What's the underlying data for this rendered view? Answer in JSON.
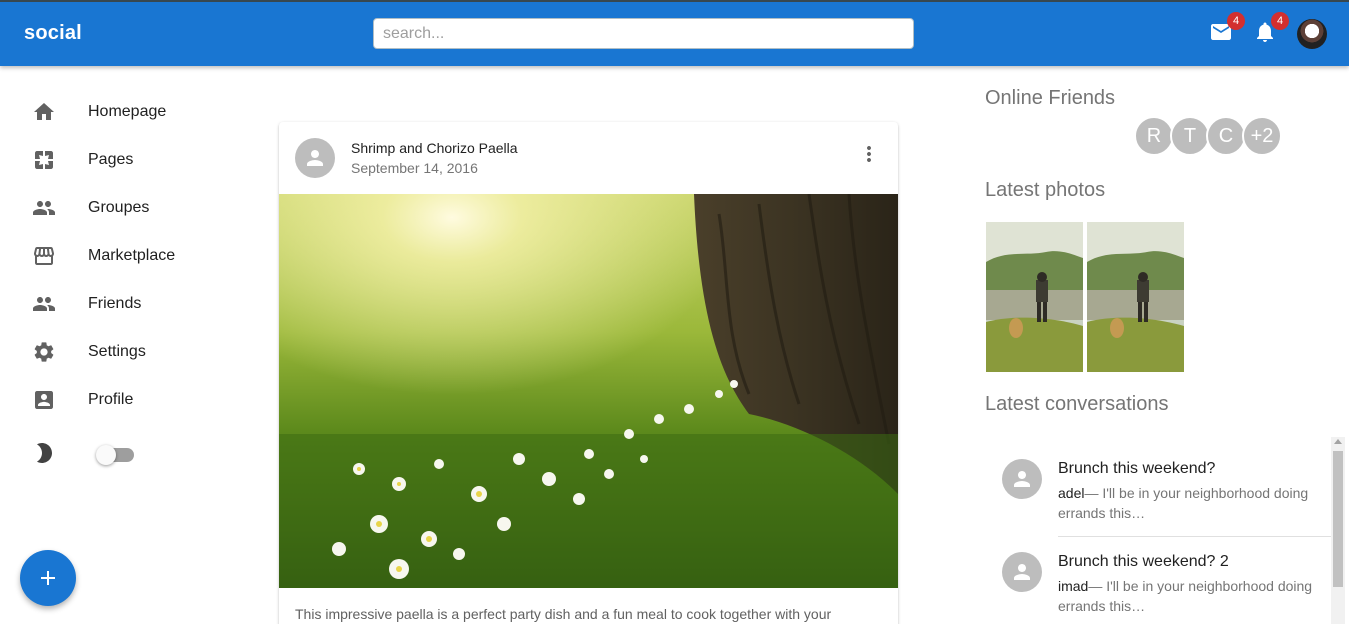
{
  "app": {
    "title": "social"
  },
  "search": {
    "placeholder": "search..."
  },
  "header": {
    "messages_badge": "4",
    "notifications_badge": "4",
    "icons": [
      "mail-icon",
      "bell-icon",
      "user-avatar"
    ]
  },
  "sidebar": {
    "items": [
      {
        "label": "Homepage",
        "icon": "home-icon"
      },
      {
        "label": "Pages",
        "icon": "pages-icon"
      },
      {
        "label": "Groupes",
        "icon": "groups-icon"
      },
      {
        "label": "Marketplace",
        "icon": "store-icon"
      },
      {
        "label": "Friends",
        "icon": "friends-icon"
      },
      {
        "label": "Settings",
        "icon": "gear-icon"
      },
      {
        "label": "Profile",
        "icon": "profile-icon"
      }
    ],
    "dark_mode": {
      "icon": "moon-icon",
      "enabled": false
    }
  },
  "fab": {
    "icon": "plus-icon"
  },
  "post": {
    "title": "Shrimp and Chorizo Paella",
    "date": "September 14, 2016",
    "image": "meadow with sunlight, white flowers and tree trunk",
    "text": "This impressive paella is a perfect party dish and a fun meal to cook together with your"
  },
  "right": {
    "online_title": "Online Friends",
    "online_friends": [
      "R",
      "T",
      "C",
      "+2"
    ],
    "photos_title": "Latest photos",
    "conversations_title": "Latest conversations",
    "conversations": [
      {
        "title": "Brunch this weekend?",
        "sender": "adel",
        "preview": "— I'll be in your neighborhood doing errands this…"
      },
      {
        "title": "Brunch this weekend? 2",
        "sender": "imad",
        "preview": "— I'll be in your neighborhood doing errands this…"
      }
    ]
  },
  "colors": {
    "primary": "#1976d2",
    "badge": "#d32f2f",
    "avatar_bg": "#bdbdbd"
  }
}
